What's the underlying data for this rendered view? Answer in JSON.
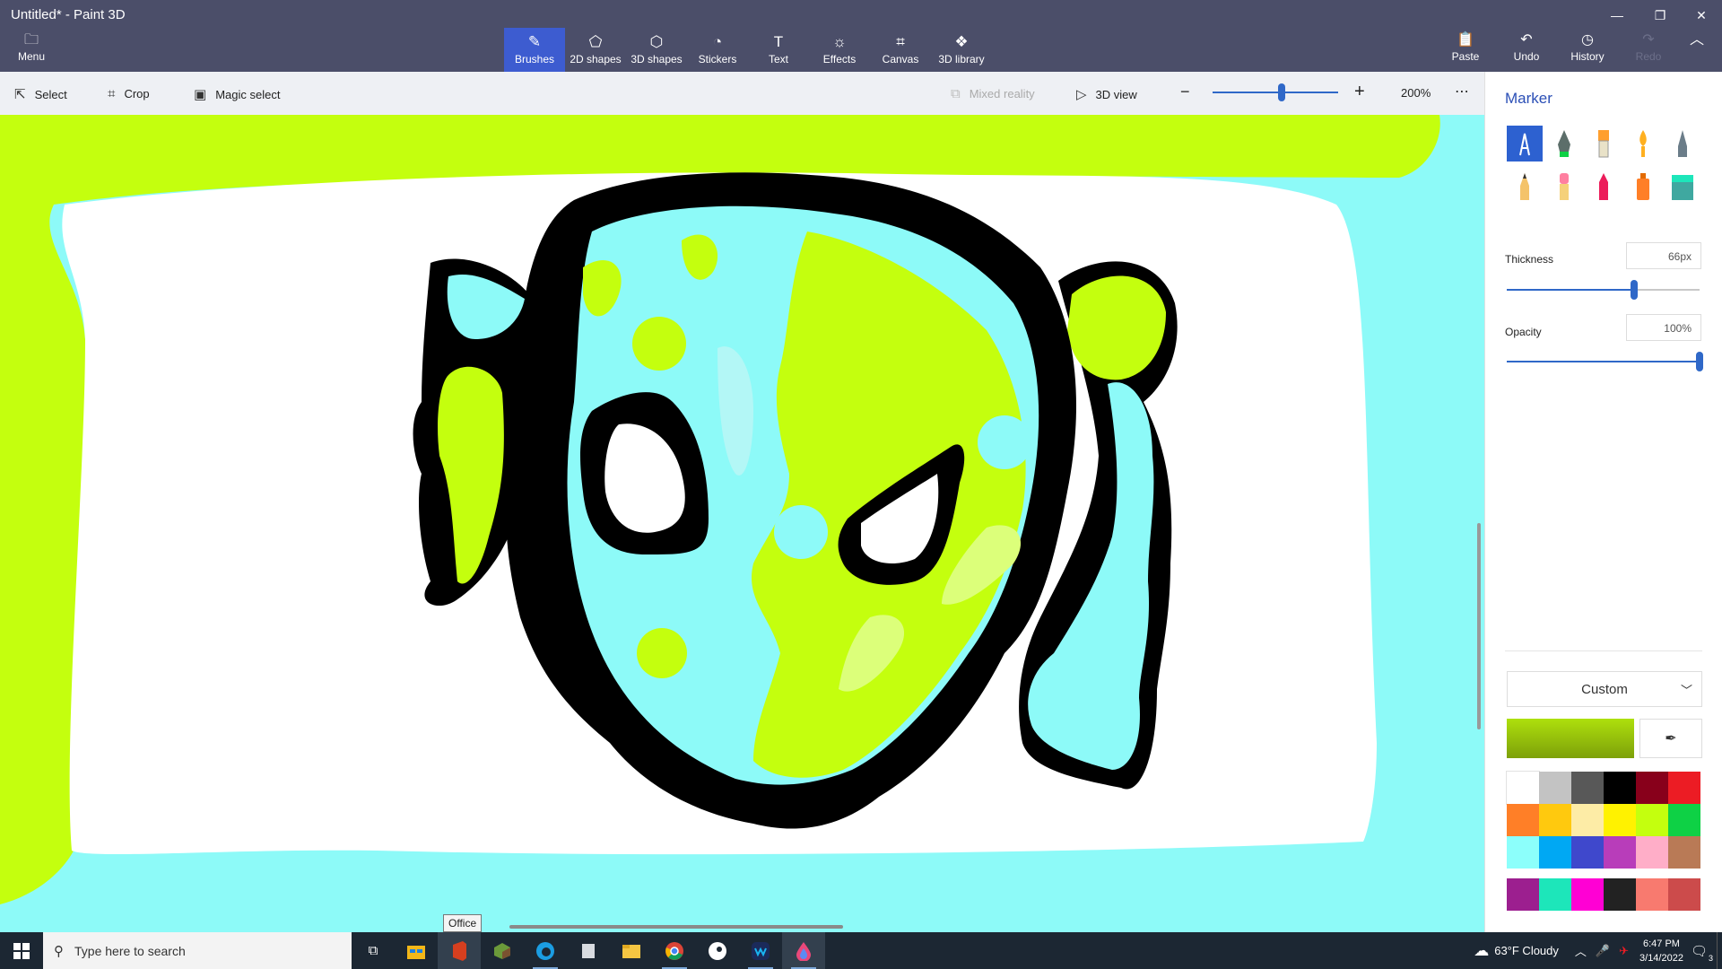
{
  "window": {
    "title": "Untitled* - Paint 3D"
  },
  "menu": {
    "label": "Menu"
  },
  "toolbar": {
    "tools": [
      {
        "label": "Brushes",
        "icon": "brush-icon",
        "active": true
      },
      {
        "label": "2D shapes",
        "icon": "2d-shapes-icon"
      },
      {
        "label": "3D shapes",
        "icon": "3d-shapes-icon"
      },
      {
        "label": "Stickers",
        "icon": "stickers-icon"
      },
      {
        "label": "Text",
        "icon": "text-icon"
      },
      {
        "label": "Effects",
        "icon": "effects-icon"
      },
      {
        "label": "Canvas",
        "icon": "canvas-icon"
      },
      {
        "label": "3D library",
        "icon": "3d-library-icon"
      }
    ],
    "paste_label": "Paste",
    "undo_label": "Undo",
    "history_label": "History",
    "redo_label": "Redo"
  },
  "subbar": {
    "select_label": "Select",
    "crop_label": "Crop",
    "magic_select_label": "Magic select",
    "mixed_reality_label": "Mixed reality",
    "view_3d_label": "3D view",
    "zoom_value": "200%",
    "zoom_level": 0.55
  },
  "panel": {
    "title": "Marker",
    "thickness_label": "Thickness",
    "thickness_value": "66px",
    "thickness_level": 0.66,
    "opacity_label": "Opacity",
    "opacity_value": "100%",
    "opacity_level": 1.0,
    "color_mode": "Custom",
    "current_color": "#aee00c",
    "brushes": [
      "marker",
      "calligraphy-pen",
      "oil-brush",
      "watercolor",
      "pixel-pen",
      "pencil",
      "eraser",
      "crayon",
      "spray-can",
      "fill"
    ],
    "palette": [
      "#ffffff",
      "#c3c3c3",
      "#585858",
      "#000000",
      "#88001b",
      "#ec1c24",
      "#ff7f27",
      "#ffc90e",
      "#fdeca6",
      "#fff200",
      "#c4ff0e",
      "#0ed145",
      "#8cfffb",
      "#00a8f3",
      "#3f48cc",
      "#b83dba",
      "#ffaec8",
      "#b97a56"
    ],
    "custom_palette": [
      "#9c1f8f",
      "#1de6ba",
      "#ff00d4",
      "#222222",
      "#f87a6f",
      "#cc4b4b"
    ]
  },
  "canvas": {
    "tooltip": "Office"
  },
  "taskbar": {
    "search_placeholder": "Type here to search",
    "weather": "63°F  Cloudy",
    "time": "6:47 PM",
    "date": "3/14/2022",
    "notification_count": "3"
  }
}
